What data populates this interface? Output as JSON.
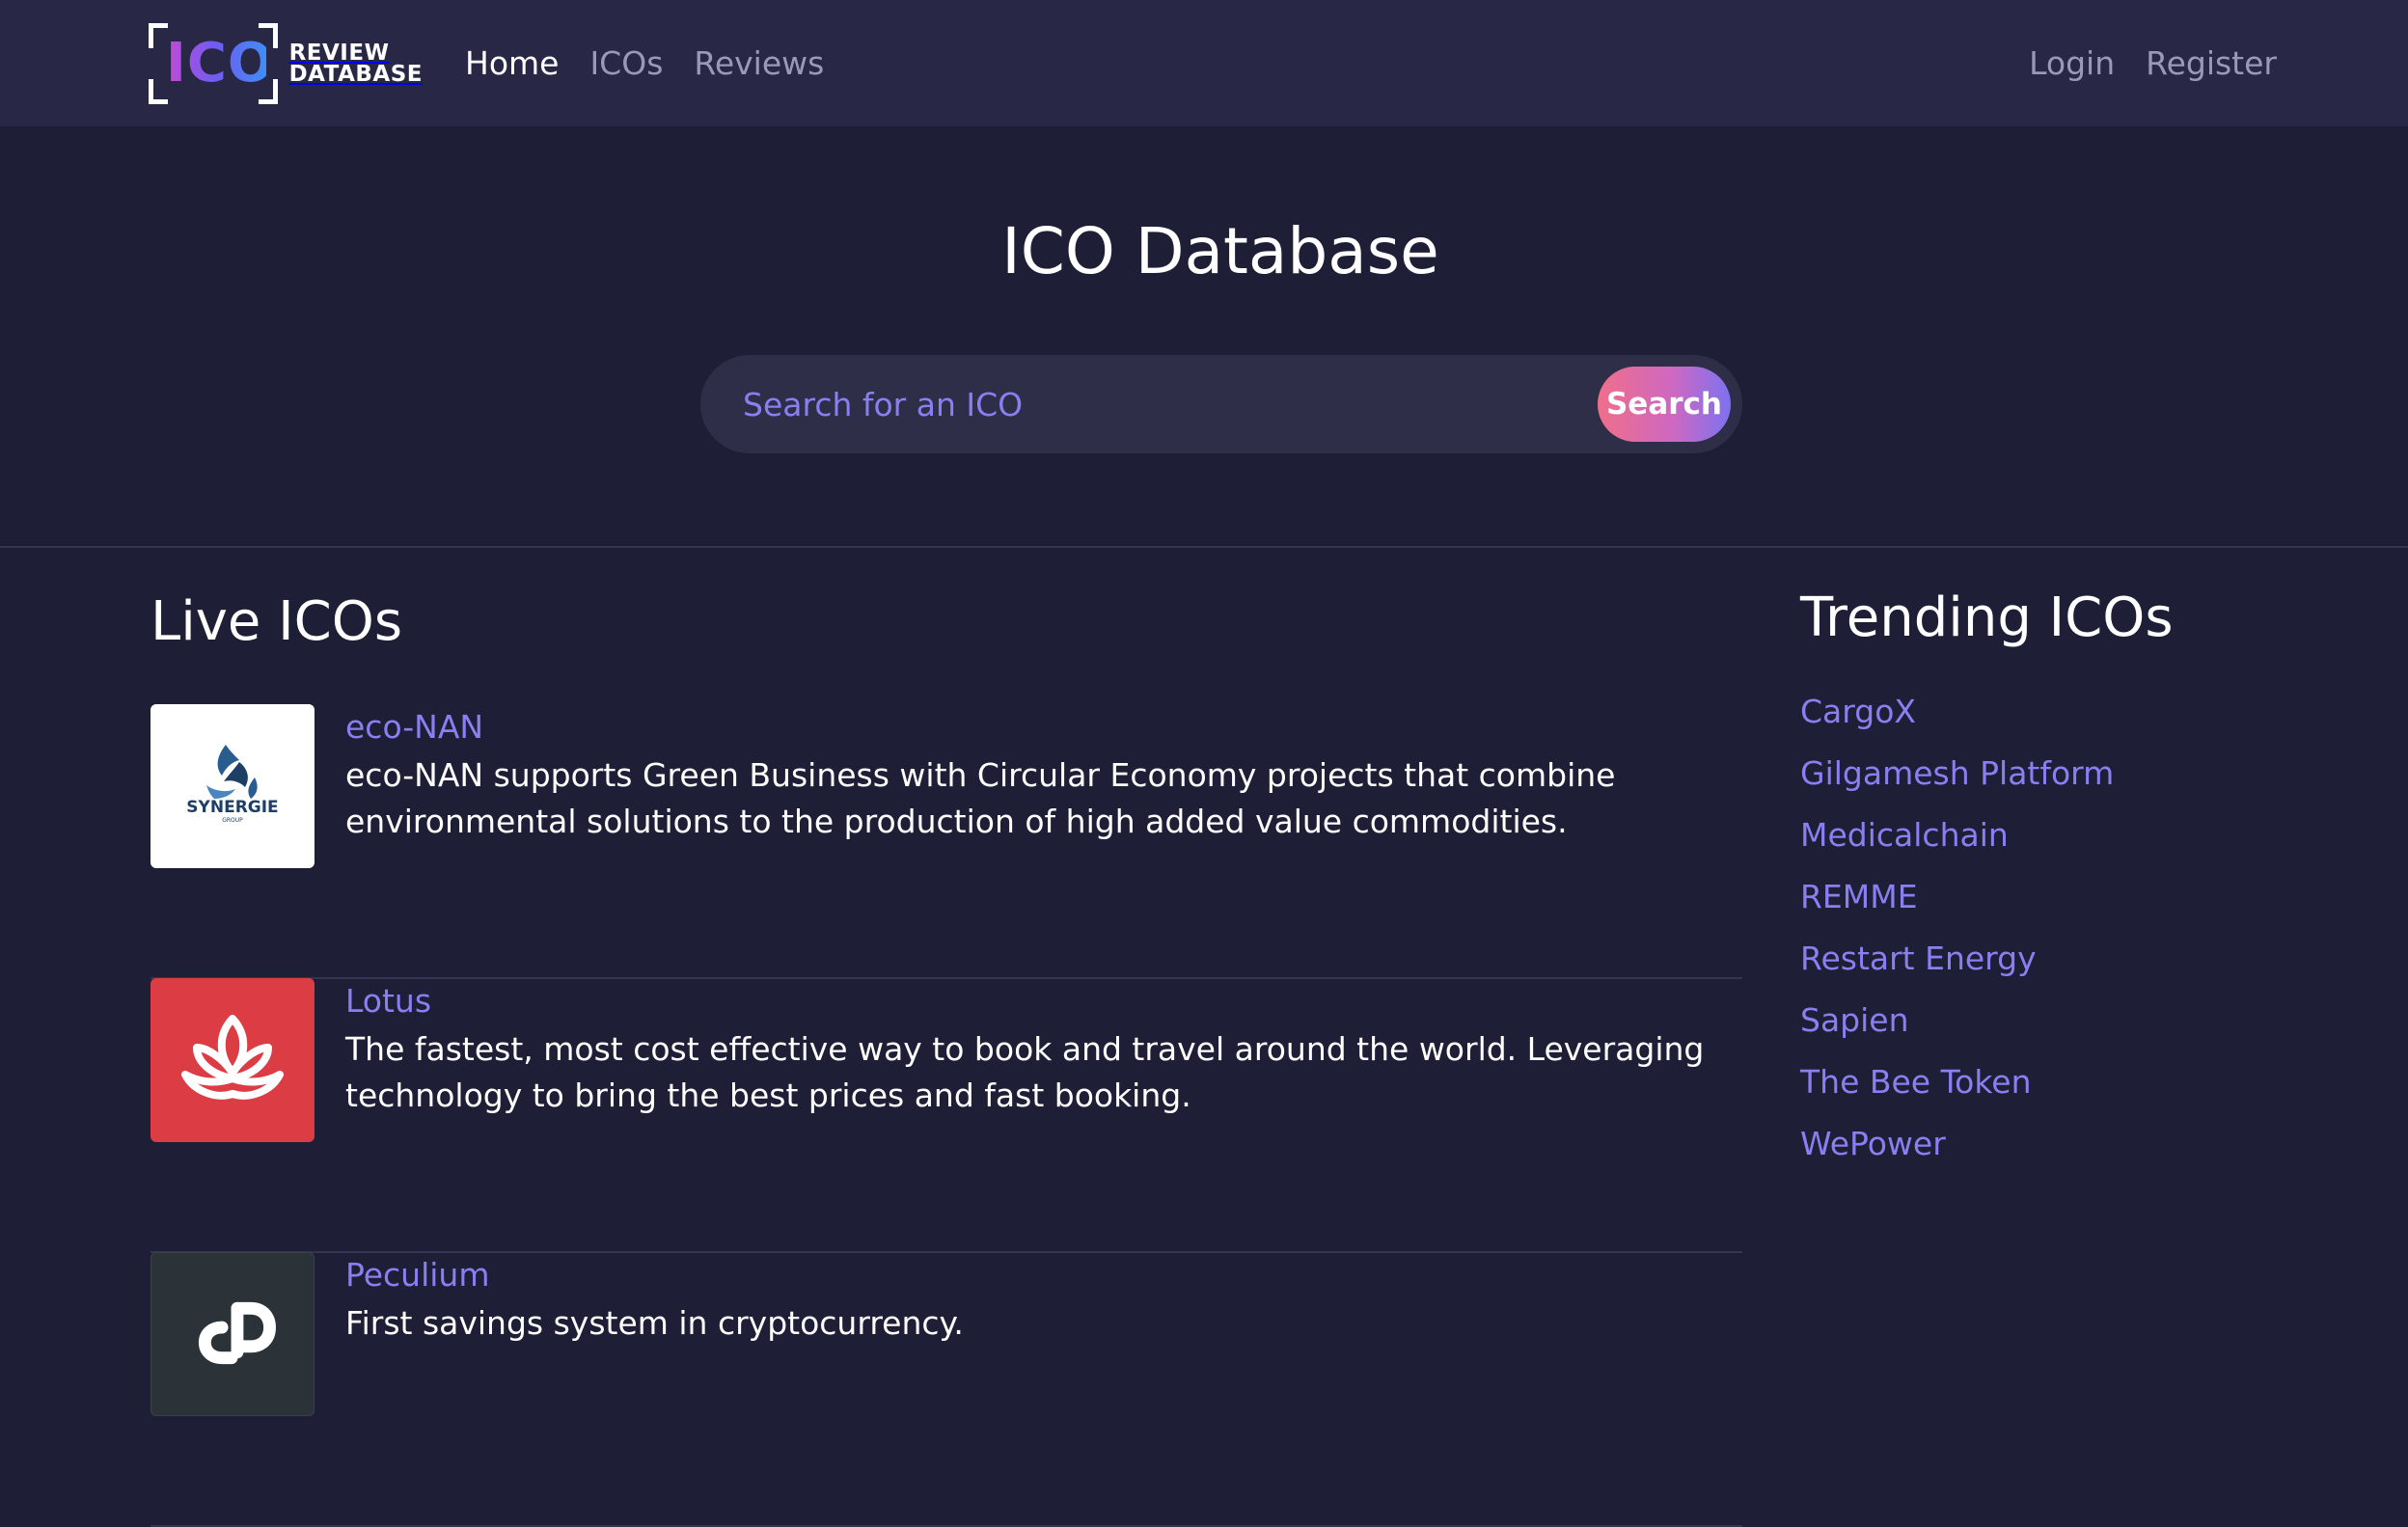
{
  "nav": {
    "logo_text": "ICO",
    "logo_sub_line1": "REVIEW",
    "logo_sub_line2": "DATABASE",
    "links": [
      "Home",
      "ICOs",
      "Reviews"
    ],
    "auth": [
      "Login",
      "Register"
    ]
  },
  "hero": {
    "title": "ICO Database",
    "search_placeholder": "Search for an ICO",
    "search_button": "Search"
  },
  "live": {
    "title": "Live ICOs",
    "items": [
      {
        "name": "eco-NAN",
        "logo_text": "SYNERGIE",
        "logo_subtext": "GROUP",
        "description": "eco-NAN supports Green Business with Circular Economy projects that combine environmental solutions to the production of high added value commodities."
      },
      {
        "name": "Lotus",
        "description": "The fastest, most cost effective way to book and travel around the world. Leveraging technology to bring the best prices and fast booking."
      },
      {
        "name": "Peculium",
        "description": "First savings system in cryptocurrency."
      }
    ]
  },
  "trending": {
    "title": "Trending ICOs",
    "items": [
      "CargoX",
      "Gilgamesh Platform",
      "Medicalchain",
      "REMME",
      "Restart Energy",
      "Sapien",
      "The Bee Token",
      "WePower"
    ]
  },
  "colors": {
    "background": "#1e1e36",
    "navbar": "#282846",
    "link_accent": "#8a7ff0",
    "lotus_red": "#dc3c43",
    "peculium_dark": "#2b3339"
  }
}
